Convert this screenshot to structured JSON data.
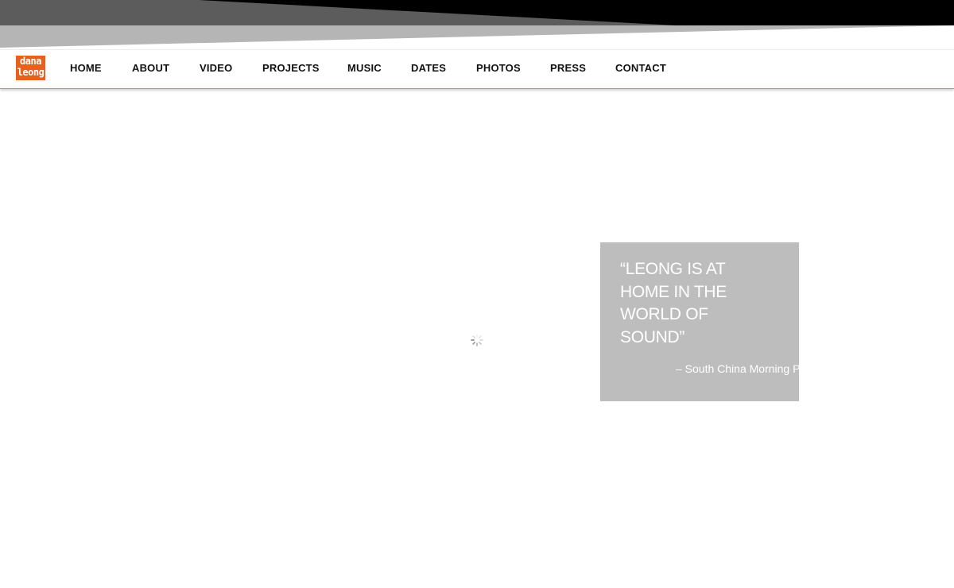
{
  "header": {
    "logo": {
      "line1": "dana",
      "line2": "leong",
      "color": "#e8601c"
    },
    "banner_colors": {
      "dark": "#000000",
      "mid": "#5c5c5c",
      "light": "#b5b5b5"
    },
    "nav_items": [
      {
        "label": "HOME"
      },
      {
        "label": "ABOUT"
      },
      {
        "label": "VIDEO"
      },
      {
        "label": "PROJECTS"
      },
      {
        "label": "MUSIC"
      },
      {
        "label": "DATES"
      },
      {
        "label": "PHOTOS"
      },
      {
        "label": "PRESS"
      },
      {
        "label": "CONTACT"
      }
    ],
    "nav_underline_color": "#c79a2a"
  },
  "main": {
    "loading_indicator": "spinner-icon",
    "quote": {
      "text": "“LEONG IS AT HOME IN THE WORLD OF SOUND”",
      "source": "– South China Morning Post",
      "background": "#bdbdbd"
    }
  }
}
